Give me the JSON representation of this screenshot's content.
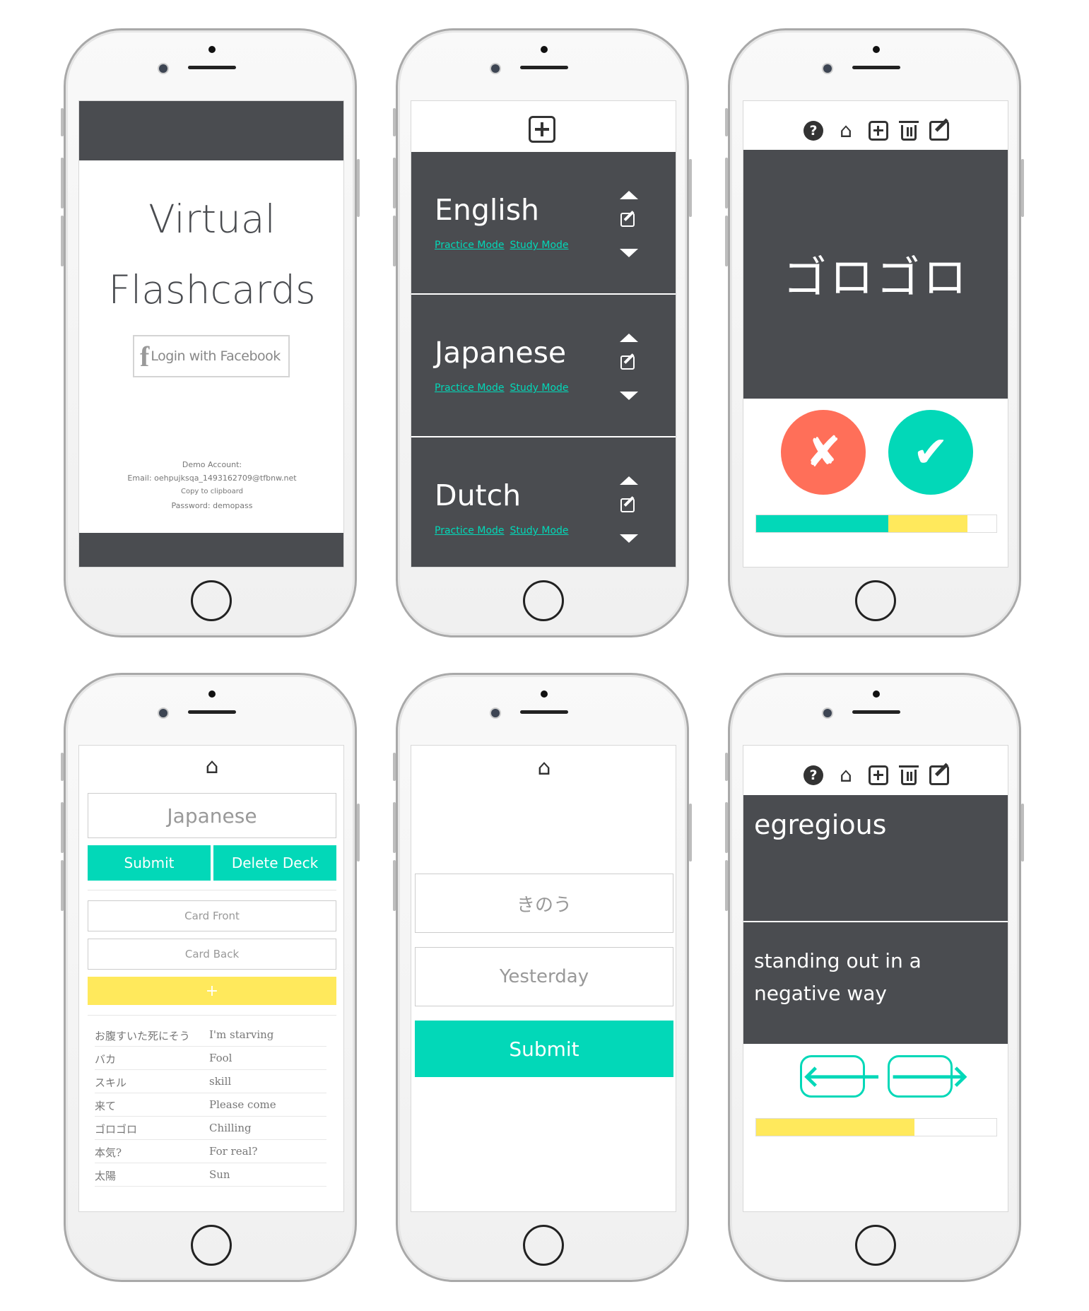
{
  "colors": {
    "dark": "#4a4c50",
    "accent": "#02d8b8",
    "wrong": "#ff6f59",
    "progress_partial": "#ffe95c"
  },
  "screen1": {
    "title_line1": "Virtual",
    "title_line2": "Flashcards",
    "login_icon": "facebook-icon",
    "login_icon_glyph": "f",
    "login_label": "Login with Facebook",
    "demo_heading": "Demo Account:",
    "demo_email": "Email: oehpujksqa_1493162709@tfbnw.net",
    "copy_label": "Copy to clipboard",
    "demo_password": "Password: demopass"
  },
  "screen2": {
    "add_icon": "plus-square-icon",
    "decks": [
      {
        "name": "English",
        "practice": "Practice Mode",
        "study": "Study Mode"
      },
      {
        "name": "Japanese",
        "practice": "Practice Mode",
        "study": "Study Mode"
      },
      {
        "name": "Dutch",
        "practice": "Practice Mode",
        "study": "Study Mode"
      }
    ]
  },
  "toolbar": {
    "icons": [
      "question-icon",
      "home-icon",
      "plus-square-icon",
      "trash-icon",
      "edit-icon"
    ],
    "help_glyph": "?"
  },
  "screen3": {
    "card_text": "ゴロゴロ",
    "wrong_glyph": "✘",
    "right_glyph": "✔",
    "progress": {
      "correct_fraction": 0.55,
      "remaining_fraction": 0.33
    }
  },
  "screen4": {
    "deck_name_value": "Japanese",
    "submit_label": "Submit",
    "delete_label": "Delete Deck",
    "card_front_placeholder": "Card Front",
    "card_back_placeholder": "Card Back",
    "add_label": "+",
    "words": [
      {
        "front": "お腹すいた死にそう",
        "back": "I'm starving"
      },
      {
        "front": "バカ",
        "back": "Fool"
      },
      {
        "front": "スキル",
        "back": "skill"
      },
      {
        "front": "来て",
        "back": "Please come"
      },
      {
        "front": "ゴロゴロ",
        "back": "Chilling"
      },
      {
        "front": "本気?",
        "back": "For real?"
      },
      {
        "front": "太陽",
        "back": "Sun"
      }
    ]
  },
  "screen5": {
    "front_value": "きのう",
    "back_value": "Yesterday",
    "submit_label": "Submit"
  },
  "screen6": {
    "front_text": "egregious",
    "back_text_line1": "standing out in a",
    "back_text_line2": "negative way",
    "prev_glyph": "🡐",
    "next_glyph": "🡒",
    "progress": {
      "fraction": 0.66
    }
  },
  "home_glyph": "⌂"
}
